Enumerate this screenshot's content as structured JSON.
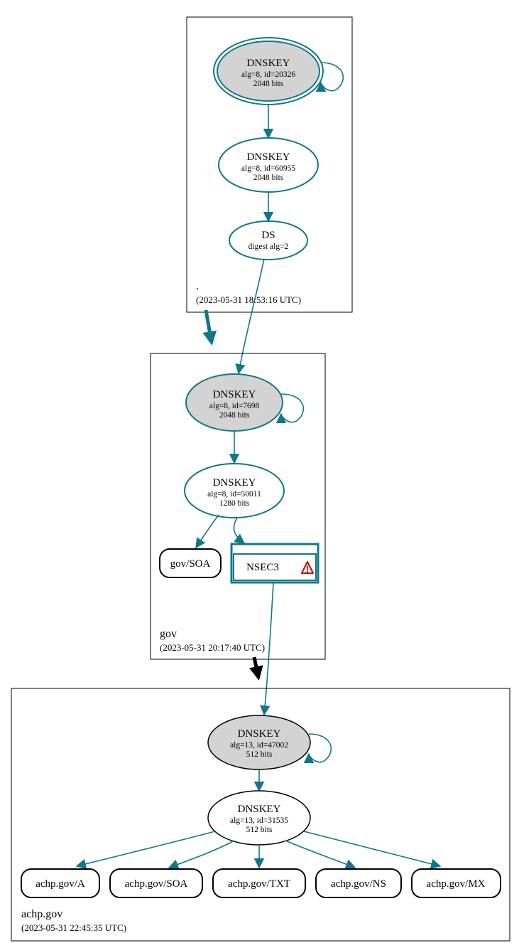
{
  "zones": {
    "root": {
      "label": ".",
      "timestamp": "(2023-05-31 18:53:16 UTC)"
    },
    "gov": {
      "label": "gov",
      "timestamp": "(2023-05-31 20:17:40 UTC)"
    },
    "achp": {
      "label": "achp.gov",
      "timestamp": "(2023-05-31 22:45:35 UTC)"
    }
  },
  "nodes": {
    "root_ksk": {
      "title": "DNSKEY",
      "l2": "alg=8, id=20326",
      "l3": "2048 bits"
    },
    "root_zsk": {
      "title": "DNSKEY",
      "l2": "alg=8, id=60955",
      "l3": "2048 bits"
    },
    "root_ds": {
      "title": "DS",
      "l2": "digest alg=2"
    },
    "gov_ksk": {
      "title": "DNSKEY",
      "l2": "alg=8, id=7698",
      "l3": "2048 bits"
    },
    "gov_zsk": {
      "title": "DNSKEY",
      "l2": "alg=8, id=50011",
      "l3": "1280 bits"
    },
    "gov_soa": {
      "label": "gov/SOA"
    },
    "gov_nsec": {
      "label": "NSEC3"
    },
    "achp_ksk": {
      "title": "DNSKEY",
      "l2": "alg=13, id=47002",
      "l3": "512 bits"
    },
    "achp_zsk": {
      "title": "DNSKEY",
      "l2": "alg=13, id=31535",
      "l3": "512 bits"
    },
    "achp_a": {
      "label": "achp.gov/A"
    },
    "achp_soa": {
      "label": "achp.gov/SOA"
    },
    "achp_txt": {
      "label": "achp.gov/TXT"
    },
    "achp_ns": {
      "label": "achp.gov/NS"
    },
    "achp_mx": {
      "label": "achp.gov/MX"
    }
  }
}
